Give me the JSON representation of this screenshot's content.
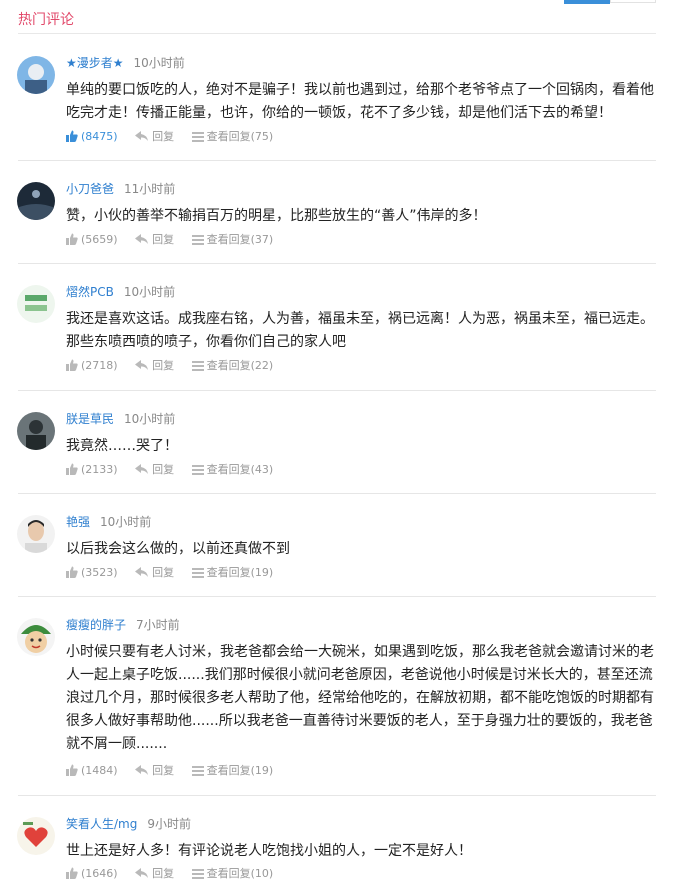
{
  "section_title": "热门评论",
  "colors": {
    "accent": "#3a8fd9",
    "title": "#e24a6b",
    "username": "#2f7fcf"
  },
  "comments": [
    {
      "user": "★漫步者★",
      "time": "10小时前",
      "text": "单纯的要口饭吃的人，绝对不是骗子！我以前也遇到过，给那个老爷爷点了一个回锅肉，看着他吃完才走！传播正能量，也许，你给的一顿饭，花不了多少钱，却是他们活下去的希望！",
      "likes": "(8475)",
      "reply": "回复",
      "view": "查看回复(75)",
      "liked": true,
      "avatar_icon": "avatar-photo-blue"
    },
    {
      "user": "小刀爸爸",
      "time": "11小时前",
      "text": "赞，小伙的善举不输捐百万的明星，比那些放生的“善人”伟岸的多！",
      "likes": "(5659)",
      "reply": "回复",
      "view": "查看回复(37)",
      "liked": false,
      "avatar_icon": "avatar-photo-night"
    },
    {
      "user": "熠然PCB",
      "time": "10小时前",
      "text": "我还是喜欢这话。成我座右铭，人为善，福虽未至，祸已远离！人为恶，祸虽未至，福已远走。那些东喷西喷的喷子，你看你们自己的家人吧",
      "likes": "(2718)",
      "reply": "回复",
      "view": "查看回复(22)",
      "liked": false,
      "avatar_icon": "avatar-logo-green"
    },
    {
      "user": "朕是草民",
      "time": "10小时前",
      "text": "我竟然……哭了！",
      "likes": "(2133)",
      "reply": "回复",
      "view": "查看回复(43)",
      "liked": false,
      "avatar_icon": "avatar-photo-person"
    },
    {
      "user": "艳强",
      "time": "10小时前",
      "text": "以后我会这么做的，以前还真做不到",
      "likes": "(3523)",
      "reply": "回复",
      "view": "查看回复(19)",
      "liked": false,
      "avatar_icon": "avatar-photo-face"
    },
    {
      "user": "瘦瘦的胖子",
      "time": "7小时前",
      "text": "小时候只要有老人讨米，我老爸都会给一大碗米，如果遇到吃饭，那么我老爸就会邀请讨米的老人一起上桌子吃饭......我们那时候很小就问老爸原因，老爸说他小时候是讨米长大的，甚至还流浪过几个月，那时候很多老人帮助了他，经常给他吃的，在解放初期，都不能吃饱饭的时期都有很多人做好事帮助他......所以我老爸一直善待讨米要饭的老人，至于身强力壮的要饭的，我老爸就不屑一顾.......",
      "likes": "(1484)",
      "reply": "回复",
      "view": "查看回复(19)",
      "liked": false,
      "avatar_icon": "avatar-cartoon-watermelon"
    },
    {
      "user": "笑看人生/mg",
      "time": "9小时前",
      "text": "世上还是好人多！有评论说老人吃饱找小姐的人，一定不是好人！",
      "likes": "(1646)",
      "reply": "回复",
      "view": "查看回复(10)",
      "liked": false,
      "avatar_icon": "avatar-cartoon-heart"
    }
  ]
}
